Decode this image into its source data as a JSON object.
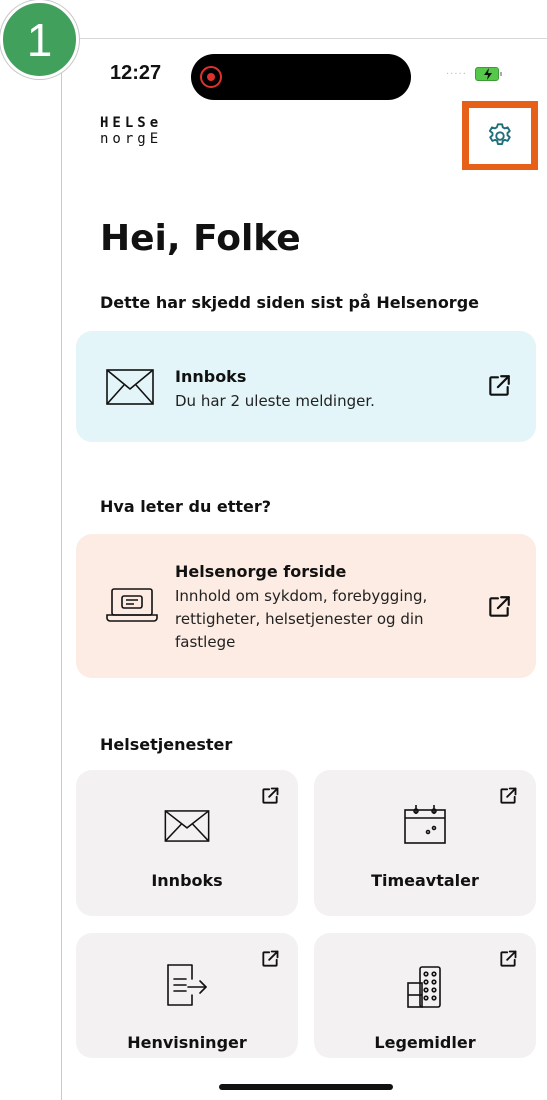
{
  "step_number": "1",
  "status_bar": {
    "time": "12:27",
    "signal": "....."
  },
  "logo": {
    "line1": "HELSe",
    "line2": "norgE"
  },
  "greeting": "Hei, Folke",
  "section_since_last": "Dette har skjedd siden sist på Helsenorge",
  "inbox_card": {
    "title": "Innboks",
    "description": "Du har 2 uleste meldinger."
  },
  "section_looking_for": "Hva leter du etter?",
  "forside_card": {
    "title": "Helsenorge forside",
    "description": "Innhold om sykdom, forebygging, rettigheter, helsetjenester og din fastlege"
  },
  "section_services": "Helsetjenester",
  "tiles": [
    {
      "label": "Innboks",
      "icon": "envelope-icon"
    },
    {
      "label": "Timeavtaler",
      "icon": "calendar-icon"
    },
    {
      "label": "Henvisninger",
      "icon": "document-arrow-icon"
    },
    {
      "label": "Legemidler",
      "icon": "pill-box-icon"
    }
  ],
  "colors": {
    "badge": "#41a05c",
    "highlight": "#e66018",
    "inbox_card": "#e3f5f8",
    "forside_card": "#fdece3",
    "tile": "#f3f1f1",
    "icon_teal": "#1f6f7a"
  }
}
